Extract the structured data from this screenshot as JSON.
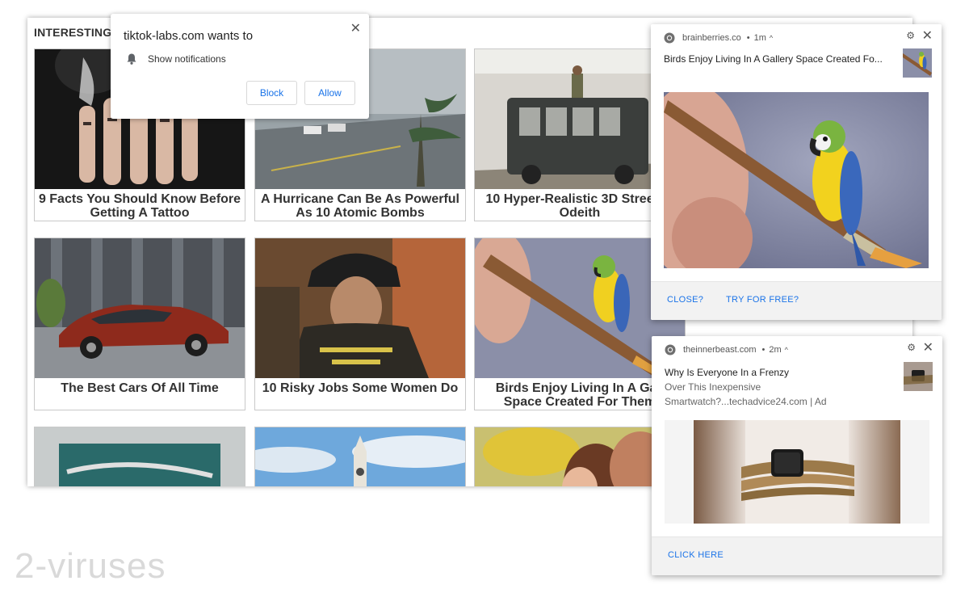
{
  "page": {
    "heading": "INTERESTING F",
    "cards": [
      {
        "caption": "9 Facts You Should Know Before Getting A Tattoo",
        "image": "tattooed-hands"
      },
      {
        "caption": "A Hurricane Can Be As Powerful As 10 Atomic Bombs",
        "image": "hurricane-palms"
      },
      {
        "caption": "10 Hyper-Realistic 3D Stree By Odeith",
        "image": "graffiti-bus"
      },
      {
        "caption": "The Best Cars Of All Time",
        "image": "red-sedan"
      },
      {
        "caption": "10 Risky Jobs Some Women Do",
        "image": "firefighter"
      },
      {
        "caption": "Birds Enjoy Living In A Gall Space Created For Them",
        "image": "parrot-brush"
      },
      {
        "caption": "",
        "image": "street-art"
      },
      {
        "caption": "",
        "image": "clock-tower"
      },
      {
        "caption": "",
        "image": "couple"
      }
    ]
  },
  "permission_prompt": {
    "title": "tiktok-labs.com wants to",
    "option": "Show notifications",
    "block_label": "Block",
    "allow_label": "Allow"
  },
  "notifications": [
    {
      "site": "brainberries.co",
      "time": "1m",
      "title": "Birds Enjoy Living In A Gallery Space Created Fo...",
      "actions": [
        "CLOSE?",
        "TRY FOR FREE?"
      ]
    },
    {
      "site": "theinnerbeast.com",
      "time": "2m",
      "title": "Why Is Everyone In a Frenzy",
      "line2": "Over This Inexpensive",
      "line3": "Smartwatch?...techadvice24.com | Ad",
      "actions": [
        "CLICK HERE"
      ]
    }
  ],
  "watermark": "2-viruses",
  "colors": {
    "link": "#1a73e8",
    "footer": "#f2f2f2"
  }
}
